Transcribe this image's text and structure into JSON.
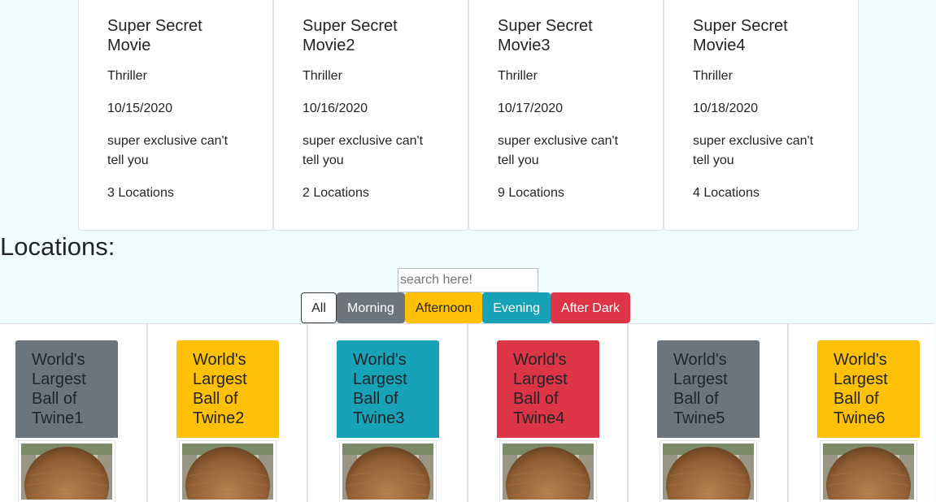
{
  "movies": [
    {
      "title_1": "Super Secret",
      "title_2": "Movie",
      "genre": "Thriller",
      "date": "10/15/2020",
      "desc_1": "super exclusive can't",
      "desc_2": "tell you",
      "locations": "3 Locations"
    },
    {
      "title_1": "Super Secret",
      "title_2": "Movie2",
      "genre": "Thriller",
      "date": "10/16/2020",
      "desc_1": "super exclusive can't",
      "desc_2": "tell you",
      "locations": "2 Locations"
    },
    {
      "title_1": "Super Secret",
      "title_2": "Movie3",
      "genre": "Thriller",
      "date": "10/17/2020",
      "desc_1": "super exclusive can't",
      "desc_2": "tell you",
      "locations": "9 Locations"
    },
    {
      "title_1": "Super Secret",
      "title_2": "Movie4",
      "genre": "Thriller",
      "date": "10/18/2020",
      "desc_1": "super exclusive can't",
      "desc_2": "tell you",
      "locations": "4 Locations"
    }
  ],
  "locations_heading": "Locations:",
  "search": {
    "placeholder": "search here!"
  },
  "filters": [
    "All",
    "Morning",
    "Afternoon",
    "Evening",
    "After Dark"
  ],
  "location_cards": [
    {
      "l1": "World's",
      "l2": "Largest",
      "l3": "Ball of",
      "l4": "Twine1",
      "color": "#6c757d",
      "text_color": "#212529"
    },
    {
      "l1": "World's",
      "l2": "Largest",
      "l3": "Ball of",
      "l4": "Twine2",
      "color": "#ffc107",
      "text_color": "#212529"
    },
    {
      "l1": "World's",
      "l2": "Largest",
      "l3": "Ball of",
      "l4": "Twine3",
      "color": "#17a2b8",
      "text_color": "#212529"
    },
    {
      "l1": "World's",
      "l2": "Largest",
      "l3": "Ball of",
      "l4": "Twine4",
      "color": "#dc3545",
      "text_color": "#212529"
    },
    {
      "l1": "World's",
      "l2": "Largest",
      "l3": "Ball of",
      "l4": "Twine5",
      "color": "#6c757d",
      "text_color": "#212529"
    },
    {
      "l1": "World's",
      "l2": "Largest",
      "l3": "Ball of",
      "l4": "Twine6",
      "color": "#ffc107",
      "text_color": "#212529"
    }
  ],
  "colors": {
    "background": "#f0fffe",
    "morning": "#6c757d",
    "afternoon": "#ffc107",
    "evening": "#17a2b8",
    "after_dark": "#dc3545"
  }
}
